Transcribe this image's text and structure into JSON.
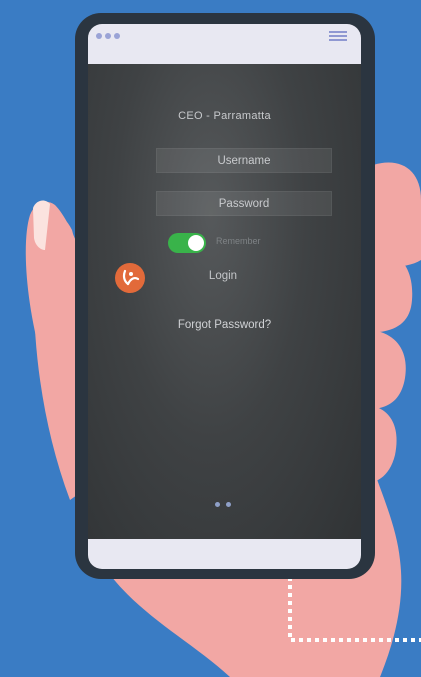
{
  "login_form": {
    "org_title": "CEO - Parramatta",
    "username_placeholder": "Username",
    "password_placeholder": "Password",
    "remember_label": "Remember",
    "remember_enabled": true,
    "login_label": "Login",
    "forgot_password_label": "Forgot Password?"
  },
  "pager": {
    "page_count": 2
  },
  "colors": {
    "background": "#3a7cc4",
    "hand": "#f2a7a4",
    "toggle_on": "#39b34a",
    "logo_orange": "#e26a3a",
    "dotted_line": "#ffffff"
  },
  "icons": {
    "window_dots": "three-dots-icon",
    "menu": "hamburger-menu-icon",
    "logo": "app-logo-icon"
  }
}
